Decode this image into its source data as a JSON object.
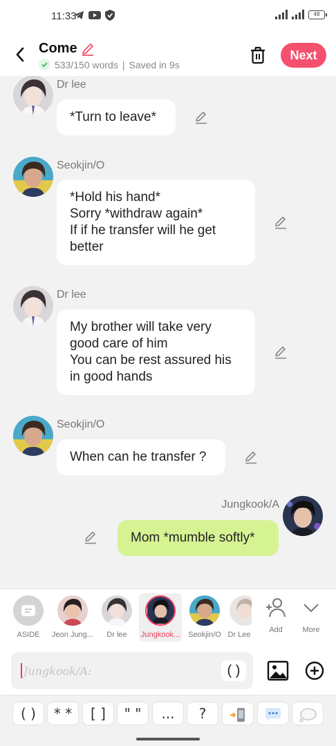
{
  "status_bar": {
    "time": "11:33",
    "left_icons": [
      "telegram-icon",
      "youtube-icon",
      "shield-icon"
    ],
    "right_icons": [
      "signal-icon",
      "signal-icon"
    ],
    "battery": "48"
  },
  "header": {
    "title": "Come",
    "word_count": "533/150 words",
    "separator": "|",
    "saved_status": "Saved in 9s",
    "next_label": "Next",
    "accent_color": "#f5506e"
  },
  "messages": [
    {
      "speaker": "Dr lee",
      "lines": [
        "*Turn to leave*"
      ],
      "side": "left"
    },
    {
      "speaker": "Seokjin/O",
      "lines": [
        "*Hold his hand*",
        "Sorry *withdraw again*",
        "If if he transfer will he get",
        "better"
      ],
      "side": "left"
    },
    {
      "speaker": "Dr lee",
      "lines": [
        "My brother will take very",
        "good care of him",
        "You can be rest assured his",
        "in good hands"
      ],
      "side": "left"
    },
    {
      "speaker": "Seokjin/O",
      "lines": [
        "When can he transfer ?"
      ],
      "side": "left"
    },
    {
      "speaker": "Jungkook/A",
      "lines": [
        "Mom *mumble softly*"
      ],
      "side": "right",
      "bubble_color": "#d6f394"
    }
  ],
  "characters": [
    {
      "label": "ASIDE",
      "selected": false
    },
    {
      "label": "Jeon Jung...",
      "selected": false
    },
    {
      "label": "Dr lee",
      "selected": false
    },
    {
      "label": "Jungkook...",
      "selected": true
    },
    {
      "label": "Seokjin/O",
      "selected": false
    },
    {
      "label": "Dr Lee",
      "selected": false
    }
  ],
  "character_actions": {
    "add_label": "Add",
    "more_label": "More"
  },
  "input": {
    "placeholder": "Jungkook/A:",
    "paren_label": "( )"
  },
  "format_toolbar": [
    "( )",
    "* *",
    "[ ]",
    "\" \"",
    "...",
    "?",
    "phone-icon",
    "speech-bubble-icon",
    "thought-bubble-icon"
  ]
}
